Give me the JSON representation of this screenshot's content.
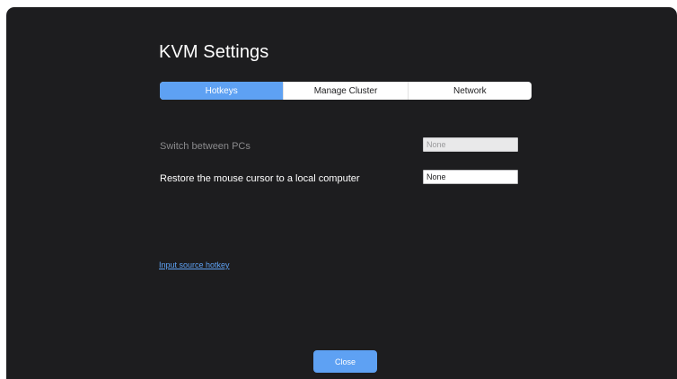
{
  "window": {
    "title": "KVM Settings"
  },
  "tabs": [
    {
      "label": "Hotkeys",
      "active": true
    },
    {
      "label": "Manage Cluster",
      "active": false
    },
    {
      "label": "Network",
      "active": false
    }
  ],
  "settings": [
    {
      "label": "Switch between PCs",
      "value": "None",
      "enabled": false
    },
    {
      "label": "Restore the mouse cursor to a local computer",
      "value": "None",
      "enabled": true
    }
  ],
  "links": {
    "input_source_hotkey": "Input source hotkey"
  },
  "footer": {
    "close_label": "Close"
  },
  "colors": {
    "accent": "#5ea1f3",
    "background": "#1d1d1f"
  }
}
